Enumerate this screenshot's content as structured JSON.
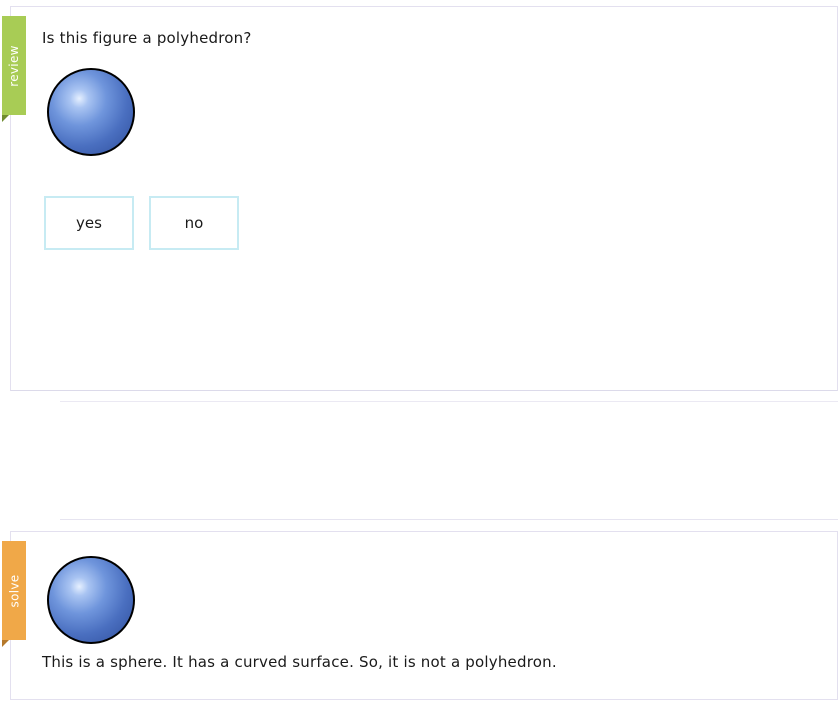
{
  "review": {
    "tab_label": "review",
    "question": "Is this figure a polyhedron?",
    "figure_icon": "sphere-icon",
    "options": [
      {
        "label": "yes"
      },
      {
        "label": "no"
      }
    ]
  },
  "solve": {
    "tab_label": "solve",
    "figure_icon": "sphere-icon",
    "explanation": "This is a sphere. It has a curved surface. So, it is not a polyhedron."
  },
  "colors": {
    "review_tab": "#a8cc55",
    "solve_tab": "#f0a848",
    "button_border": "#c7ebf3",
    "sphere_blue": "#4a6fc0"
  }
}
